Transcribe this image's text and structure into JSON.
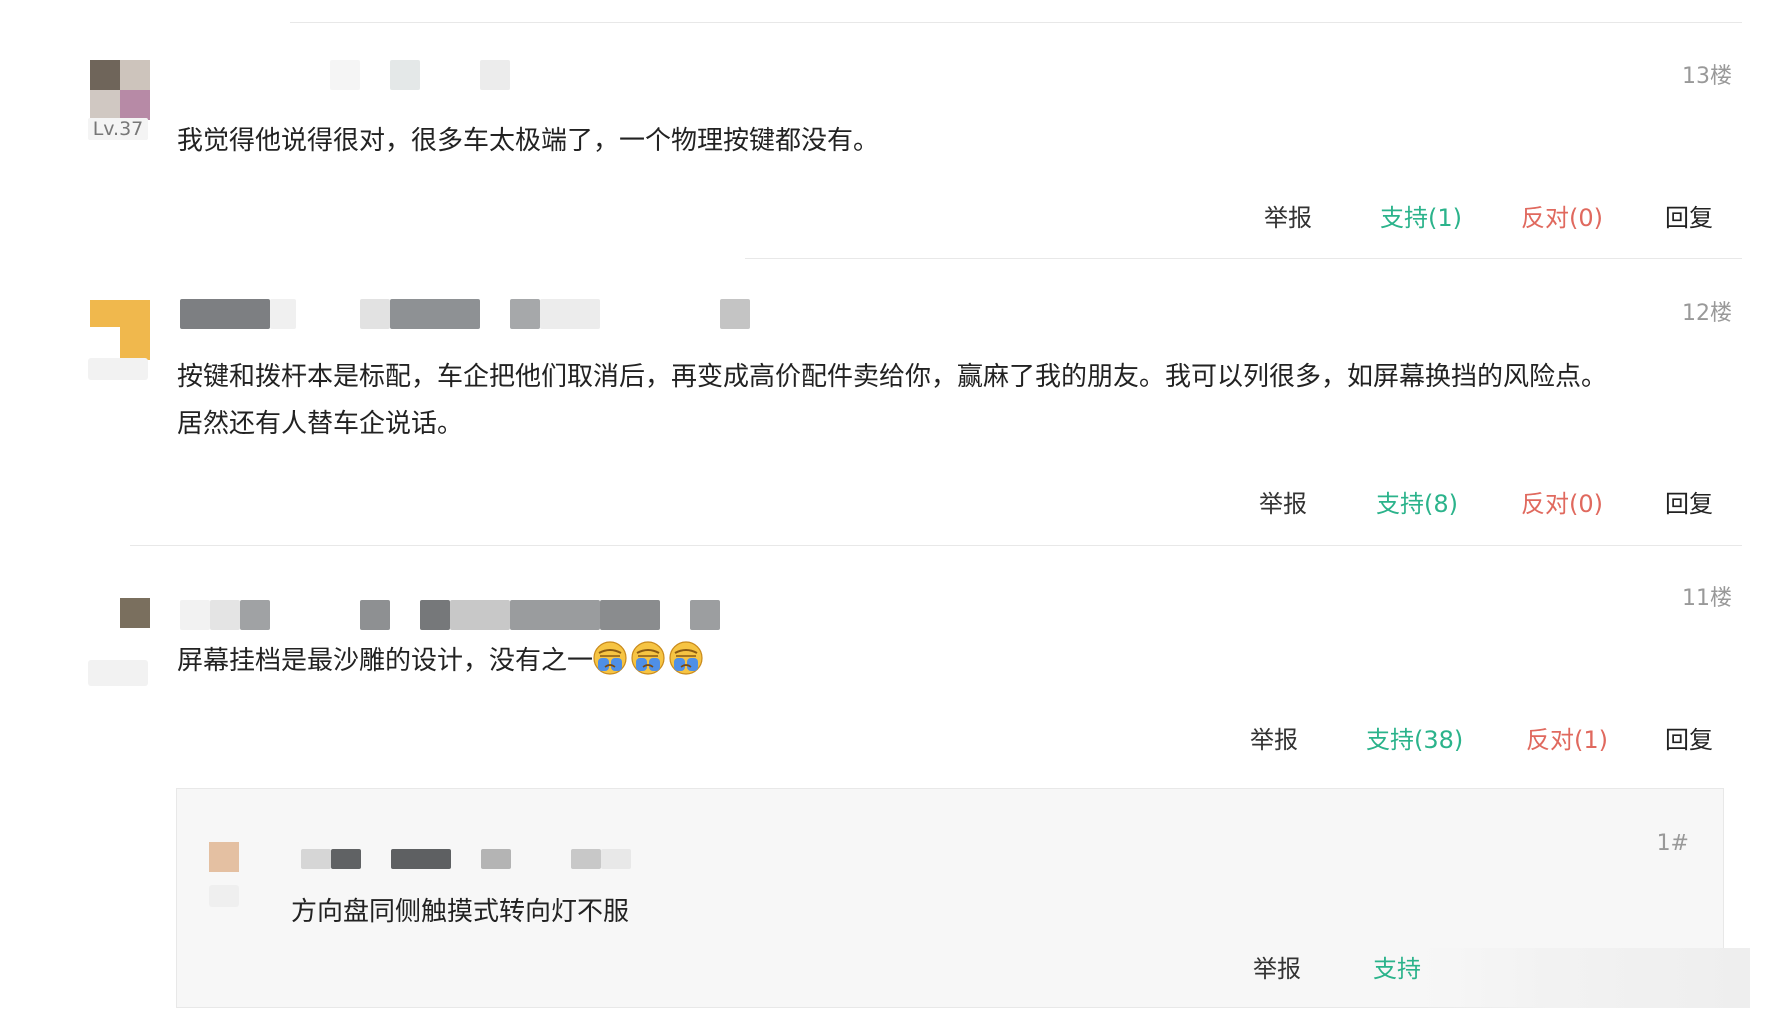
{
  "comments": [
    {
      "floor": "13楼",
      "level": "Lv.37",
      "content_lines": [
        "我觉得他说得很对，很多车太极端了，一个物理按键都没有。"
      ],
      "actions": {
        "report": "举报",
        "support": "支持(1)",
        "oppose": "反对(0)",
        "reply": "回复"
      }
    },
    {
      "floor": "12楼",
      "content_lines": [
        "按键和拨杆本是标配，车企把他们取消后，再变成高价配件卖给你，赢麻了我的朋友。我可以列很多，如屏幕换挡的风险点。",
        "居然还有人替车企说话。"
      ],
      "actions": {
        "report": "举报",
        "support": "支持(8)",
        "oppose": "反对(0)",
        "reply": "回复"
      }
    },
    {
      "floor": "11楼",
      "content_lines": [
        "屏幕挂档是最沙雕的设计，没有之一"
      ],
      "emojis": [
        "crying-face-icon",
        "crying-face-icon",
        "crying-face-icon"
      ],
      "actions": {
        "report": "举报",
        "support": "支持(38)",
        "oppose": "反对(1)",
        "reply": "回复"
      }
    }
  ],
  "nested_reply": {
    "floor": "1#",
    "content": "方向盘同侧触摸式转向灯不服",
    "actions": {
      "report": "举报",
      "support": "支持"
    }
  },
  "colors": {
    "support": "#2bb38b",
    "oppose": "#e0695e",
    "floor": "#999999",
    "divider": "#e8e8e8"
  }
}
